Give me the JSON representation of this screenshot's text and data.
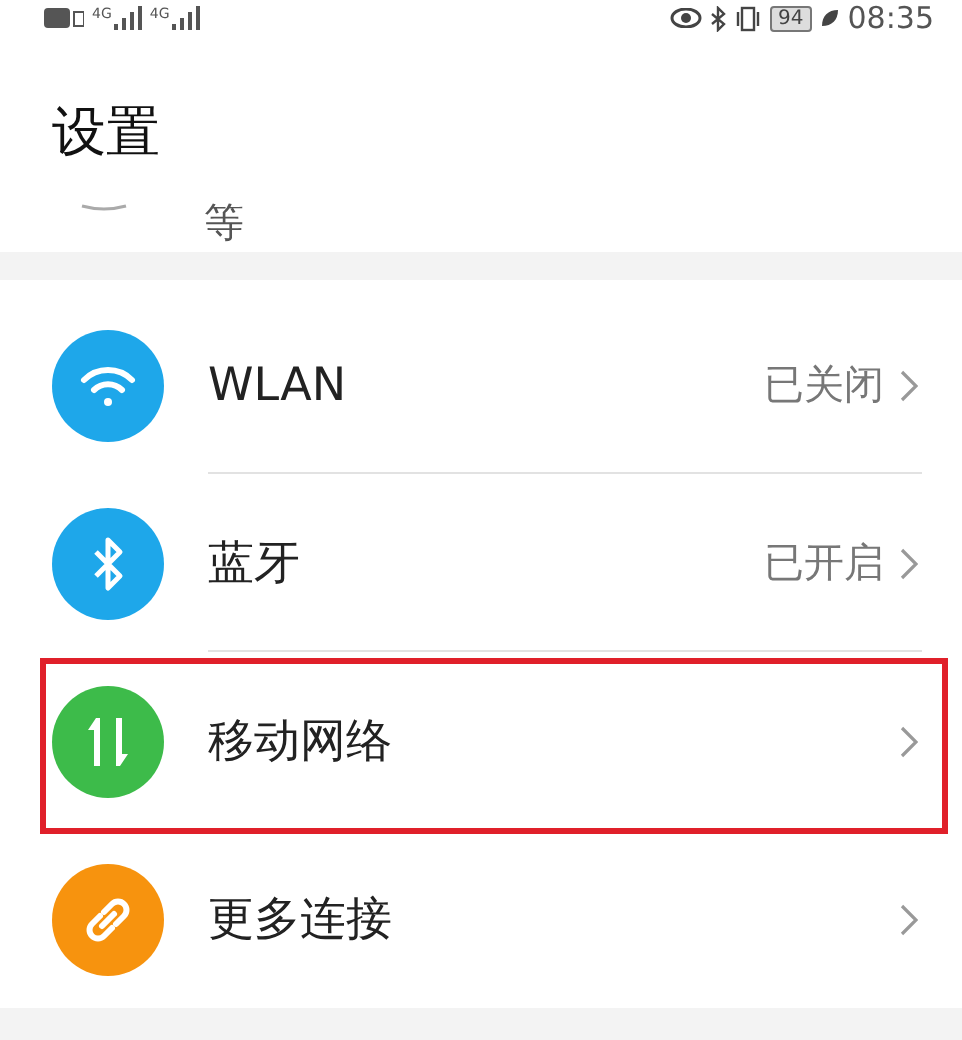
{
  "status_bar": {
    "network_labels": [
      "4G",
      "4G"
    ],
    "battery": "94",
    "time": "08:35"
  },
  "title": "设置",
  "partial_item": {
    "label": "等"
  },
  "items": [
    {
      "label": "WLAN",
      "value": "已关闭",
      "color": "#1ea7ea",
      "highlighted": false
    },
    {
      "label": "蓝牙",
      "value": "已开启",
      "color": "#1ea7ea",
      "highlighted": false
    },
    {
      "label": "移动网络",
      "color": "#3dbb4a",
      "highlighted": true
    },
    {
      "label": "更多连接",
      "color": "#f7930e",
      "highlighted": false
    }
  ]
}
